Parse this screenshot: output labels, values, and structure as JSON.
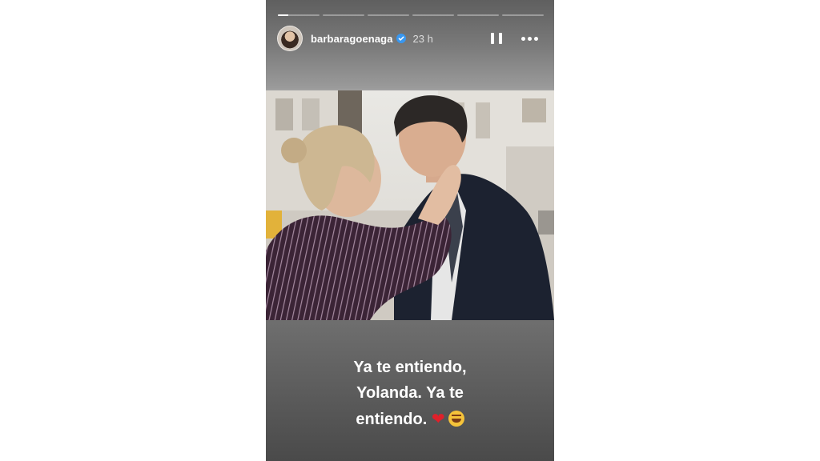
{
  "story": {
    "progress_segments": [
      0.25,
      0,
      0,
      0,
      0,
      0
    ],
    "username": "barbaragoenaga",
    "verified_icon": "verified-badge-icon",
    "time_ago": "23 h",
    "pause_icon": "pause-icon",
    "more_icon": "more-options-icon",
    "photo": "photo-woman-touching-man-face",
    "caption_lines": [
      "Ya te entiendo,",
      "Yolanda. Ya te",
      "entiendo."
    ],
    "caption_emojis": [
      "red-heart-emoji",
      "rolling-on-floor-laughing-emoji"
    ],
    "colors": {
      "text": "#ffffff",
      "verified": "#3897f0",
      "heart": "#e0202a"
    }
  }
}
